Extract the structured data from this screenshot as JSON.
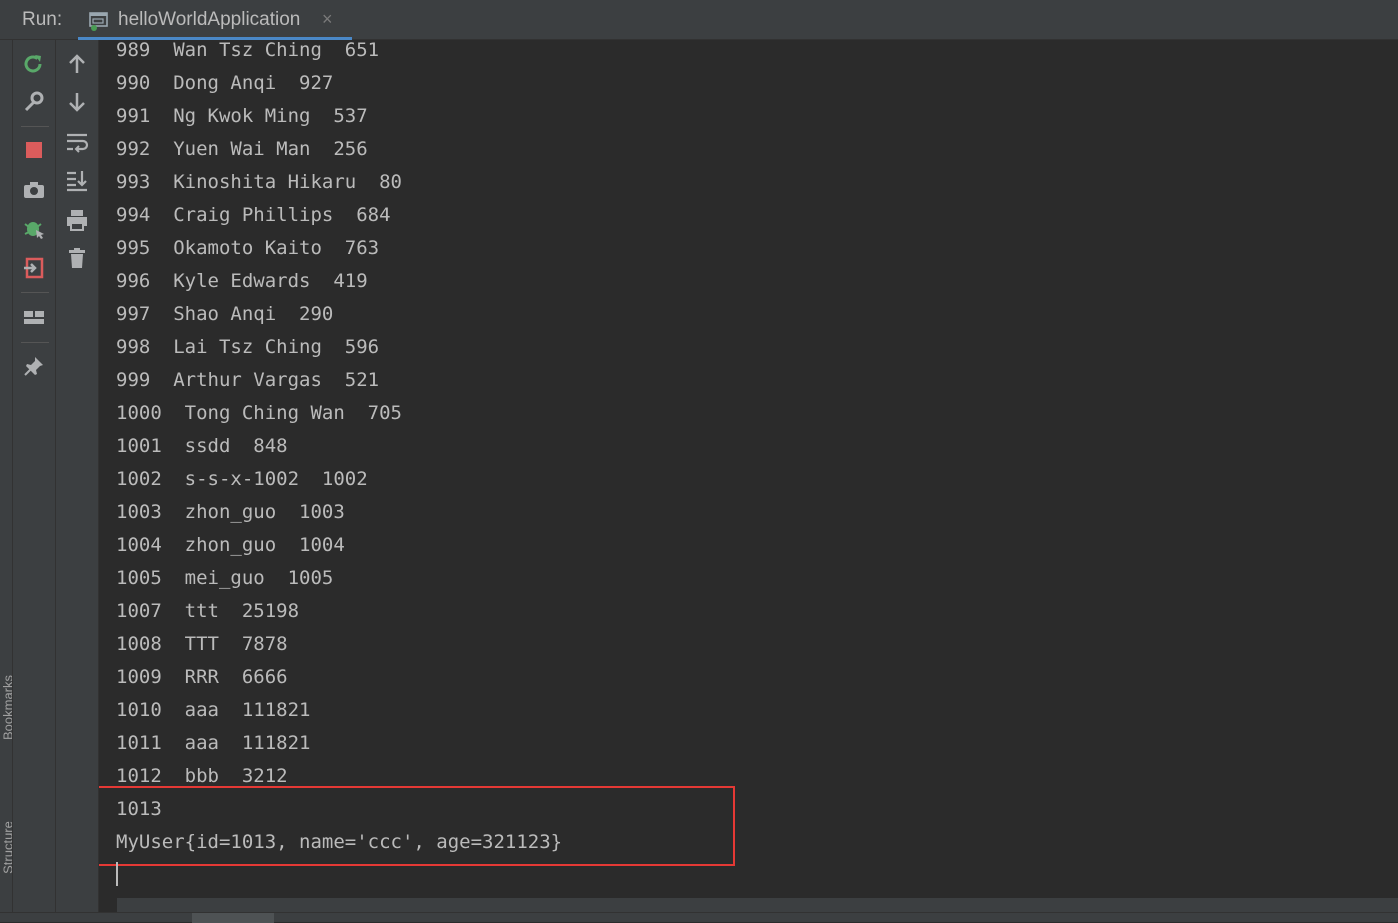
{
  "header": {
    "run_label": "Run:",
    "tab_title": "helloWorldApplication",
    "tab_close": "×"
  },
  "side_stripe": {
    "bookmarks_label": "Bookmarks",
    "structure_label": "Structure"
  },
  "toolbar": {
    "left_column": [
      "rerun-icon",
      "wrench-icon",
      "stop-icon",
      "camera-icon",
      "debug-icon",
      "exit-icon",
      "layout-icon",
      "pin-icon"
    ],
    "right_column": [
      "arrow-up-icon",
      "arrow-down-icon",
      "soft-wrap-icon",
      "scroll-to-end-icon",
      "print-icon",
      "trash-icon"
    ]
  },
  "console": {
    "lines": [
      "989  Wan Tsz Ching  651",
      "990  Dong Anqi  927",
      "991  Ng Kwok Ming  537",
      "992  Yuen Wai Man  256",
      "993  Kinoshita Hikaru  80",
      "994  Craig Phillips  684",
      "995  Okamoto Kaito  763",
      "996  Kyle Edwards  419",
      "997  Shao Anqi  290",
      "998  Lai Tsz Ching  596",
      "999  Arthur Vargas  521",
      "1000  Tong Ching Wan  705",
      "1001  ssdd  848",
      "1002  s-s-x-1002  1002",
      "1003  zhon_guo  1003",
      "1004  zhon_guo  1004",
      "1005  mei_guo  1005",
      "1007  ttt  25198",
      "1008  TTT  7878",
      "1009  RRR  6666",
      "1010  aaa  111821",
      "1011  aaa  111821",
      "1012  bbb  3212",
      "1013",
      "MyUser{id=1013, name='ccc', age=321123}"
    ]
  },
  "colors": {
    "background": "#2b2b2b",
    "panel": "#3c3f41",
    "text": "#bbbbbb",
    "highlight_border": "#e53935",
    "tab_accent": "#4a88c7"
  }
}
